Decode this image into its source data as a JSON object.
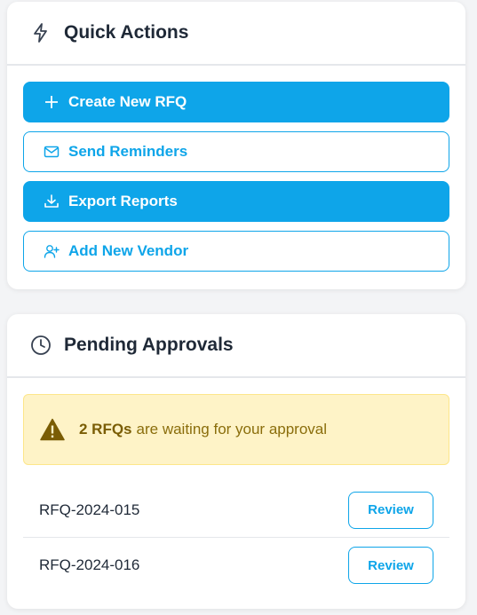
{
  "quick_actions": {
    "title": "Quick Actions",
    "icon": "lightning-icon",
    "buttons": [
      {
        "label": "Create New RFQ",
        "icon": "plus-icon",
        "style": "primary"
      },
      {
        "label": "Send Reminders",
        "icon": "envelope-icon",
        "style": "outline"
      },
      {
        "label": "Export Reports",
        "icon": "download-icon",
        "style": "primary"
      },
      {
        "label": "Add New Vendor",
        "icon": "user-plus-icon",
        "style": "outline"
      }
    ]
  },
  "pending_approvals": {
    "title": "Pending Approvals",
    "icon": "clock-icon",
    "alert": {
      "count_text": "2 RFQs",
      "message": "are waiting for your approval",
      "icon": "warning-icon"
    },
    "items": [
      {
        "id": "RFQ-2024-015",
        "action_label": "Review"
      },
      {
        "id": "RFQ-2024-016",
        "action_label": "Review"
      }
    ]
  },
  "colors": {
    "primary": "#0ea5e9",
    "alert_bg": "#fef3c7",
    "alert_text": "#8a6d0b"
  }
}
